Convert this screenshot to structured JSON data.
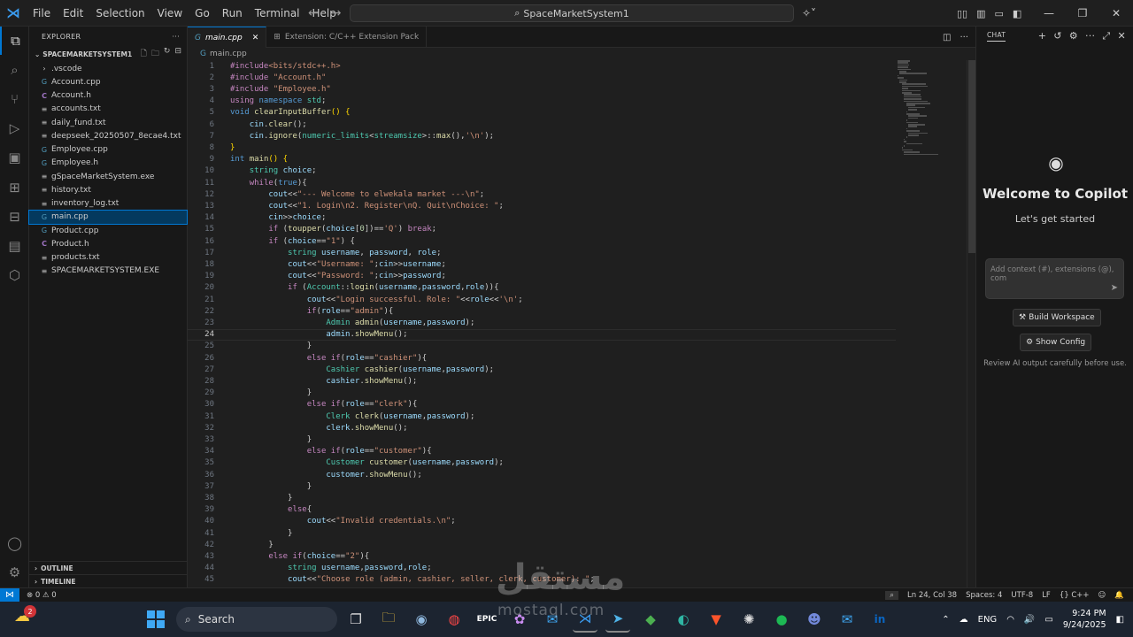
{
  "menu": [
    "File",
    "Edit",
    "Selection",
    "View",
    "Go",
    "Run",
    "Terminal",
    "Help"
  ],
  "search_label": "SpaceMarketSystem1",
  "explorer": {
    "title": "EXPLORER",
    "folder": "SPACEMARKETSYSTEM1",
    "files": [
      {
        "name": ".vscode",
        "type": "folder"
      },
      {
        "name": "Account.cpp",
        "type": "cpp"
      },
      {
        "name": "Account.h",
        "type": "h"
      },
      {
        "name": "accounts.txt",
        "type": "txt"
      },
      {
        "name": "daily_fund.txt",
        "type": "txt"
      },
      {
        "name": "deepseek_20250507_8ecae4.txt",
        "type": "txt"
      },
      {
        "name": "Employee.cpp",
        "type": "cpp"
      },
      {
        "name": "Employee.h",
        "type": "cpp"
      },
      {
        "name": "gSpaceMarketSystem.exe",
        "type": "txt"
      },
      {
        "name": "history.txt",
        "type": "txt"
      },
      {
        "name": "inventory_log.txt",
        "type": "txt"
      },
      {
        "name": "main.cpp",
        "type": "cpp"
      },
      {
        "name": "Product.cpp",
        "type": "cpp"
      },
      {
        "name": "Product.h",
        "type": "h"
      },
      {
        "name": "products.txt",
        "type": "txt"
      },
      {
        "name": "SPACEMARKETSYSTEM.EXE",
        "type": "txt"
      }
    ],
    "outline": "OUTLINE",
    "timeline": "TIMELINE"
  },
  "tabs": [
    {
      "label": "main.cpp",
      "active": true
    },
    {
      "label": "Extension: C/C++ Extension Pack",
      "active": false
    }
  ],
  "breadcrumb": "main.cpp",
  "code": {
    "current_line": 24,
    "lines": [
      {
        "n": "1",
        "html": "<span class='c'>#include</span><span class='s'>&lt;bits/stdc++.h&gt;</span>"
      },
      {
        "n": "2",
        "html": "<span class='c'>#include</span> <span class='s'>\"Account.h\"</span>"
      },
      {
        "n": "3",
        "html": "<span class='c'>#include</span> <span class='s'>\"Employee.h\"</span>"
      },
      {
        "n": "4",
        "html": "<span class='c'>using</span> <span class='k'>namespace</span> <span class='t'>std</span>;"
      },
      {
        "n": "5",
        "html": "<span class='k'>void</span> <span class='f'>clearInputBuffer</span><span class='p'>()</span> <span class='p'>{</span>"
      },
      {
        "n": "6",
        "html": "    <span class='v'>cin</span>.<span class='f'>clear</span>();"
      },
      {
        "n": "7",
        "html": "    <span class='v'>cin</span>.<span class='f'>ignore</span>(<span class='t'>numeric_limits</span>&lt;<span class='t'>streamsize</span>&gt;::<span class='f'>max</span>(),<span class='s'>'\\n'</span>);"
      },
      {
        "n": "8",
        "html": "<span class='p'>}</span>"
      },
      {
        "n": "9",
        "html": "<span class='k'>int</span> <span class='f'>main</span><span class='p'>()</span> <span class='p'>{</span>"
      },
      {
        "n": "10",
        "html": "    <span class='t'>string</span> <span class='v'>choice</span>;"
      },
      {
        "n": "11",
        "html": "    <span class='c'>while</span>(<span class='k'>true</span>){"
      },
      {
        "n": "12",
        "html": "        <span class='v'>cout</span>&lt;&lt;<span class='s'>\"--- Welcome to elwekala market ---\\n\"</span>;"
      },
      {
        "n": "13",
        "html": "        <span class='v'>cout</span>&lt;&lt;<span class='s'>\"1. Login\\n2. Register\\nQ. Quit\\nChoice: \"</span>;"
      },
      {
        "n": "14",
        "html": "        <span class='v'>cin</span>&gt;&gt;<span class='v'>choice</span>;"
      },
      {
        "n": "15",
        "html": "        <span class='c'>if</span> (<span class='f'>toupper</span>(<span class='v'>choice</span>[<span class='n'>0</span>])==<span class='s'>'Q'</span>) <span class='c'>break</span>;"
      },
      {
        "n": "16",
        "html": "        <span class='c'>if</span> (<span class='v'>choice</span>==<span class='s'>\"1\"</span>) {"
      },
      {
        "n": "17",
        "html": "            <span class='t'>string</span> <span class='v'>username</span>, <span class='v'>password</span>, <span class='v'>role</span>;"
      },
      {
        "n": "18",
        "html": "            <span class='v'>cout</span>&lt;&lt;<span class='s'>\"Username: \"</span>;<span class='v'>cin</span>&gt;&gt;<span class='v'>username</span>;"
      },
      {
        "n": "19",
        "html": "            <span class='v'>cout</span>&lt;&lt;<span class='s'>\"Password: \"</span>;<span class='v'>cin</span>&gt;&gt;<span class='v'>password</span>;"
      },
      {
        "n": "20",
        "html": "            <span class='c'>if</span> (<span class='t'>Account</span>::<span class='f'>login</span>(<span class='v'>username</span>,<span class='v'>password</span>,<span class='v'>role</span>)){"
      },
      {
        "n": "21",
        "html": "                <span class='v'>cout</span>&lt;&lt;<span class='s'>\"Login successful. Role: \"</span>&lt;&lt;<span class='v'>role</span>&lt;&lt;<span class='s'>'\\n'</span>;"
      },
      {
        "n": "22",
        "html": "                <span class='c'>if</span>(<span class='v'>role</span>==<span class='s'>\"admin\"</span>){"
      },
      {
        "n": "23",
        "html": "                    <span class='t'>Admin</span> <span class='f'>admin</span>(<span class='v'>username</span>,<span class='v'>password</span>);"
      },
      {
        "n": "24",
        "html": "                    <span class='v'>admin</span>.<span class='f'>showMenu</span>();"
      },
      {
        "n": "25",
        "html": "                }"
      },
      {
        "n": "26",
        "html": "                <span class='c'>else if</span>(<span class='v'>role</span>==<span class='s'>\"cashier\"</span>){"
      },
      {
        "n": "27",
        "html": "                    <span class='t'>Cashier</span> <span class='f'>cashier</span>(<span class='v'>username</span>,<span class='v'>password</span>);"
      },
      {
        "n": "28",
        "html": "                    <span class='v'>cashier</span>.<span class='f'>showMenu</span>();"
      },
      {
        "n": "29",
        "html": "                }"
      },
      {
        "n": "30",
        "html": "                <span class='c'>else if</span>(<span class='v'>role</span>==<span class='s'>\"clerk\"</span>){"
      },
      {
        "n": "31",
        "html": "                    <span class='t'>Clerk</span> <span class='f'>clerk</span>(<span class='v'>username</span>,<span class='v'>password</span>);"
      },
      {
        "n": "32",
        "html": "                    <span class='v'>clerk</span>.<span class='f'>showMenu</span>();"
      },
      {
        "n": "33",
        "html": "                }"
      },
      {
        "n": "34",
        "html": "                <span class='c'>else if</span>(<span class='v'>role</span>==<span class='s'>\"customer\"</span>){"
      },
      {
        "n": "35",
        "html": "                    <span class='t'>Customer</span> <span class='f'>customer</span>(<span class='v'>username</span>,<span class='v'>password</span>);"
      },
      {
        "n": "36",
        "html": "                    <span class='v'>customer</span>.<span class='f'>showMenu</span>();"
      },
      {
        "n": "37",
        "html": "                }"
      },
      {
        "n": "38",
        "html": "            }"
      },
      {
        "n": "39",
        "html": "            <span class='c'>else</span>{"
      },
      {
        "n": "40",
        "html": "                <span class='v'>cout</span>&lt;&lt;<span class='s'>\"Invalid credentials.\\n\"</span>;"
      },
      {
        "n": "41",
        "html": "            }"
      },
      {
        "n": "42",
        "html": "        }"
      },
      {
        "n": "43",
        "html": "        <span class='c'>else if</span>(<span class='v'>choice</span>==<span class='s'>\"2\"</span>){"
      },
      {
        "n": "44",
        "html": "            <span class='t'>string</span> <span class='v'>username</span>,<span class='v'>password</span>,<span class='v'>role</span>;"
      },
      {
        "n": "45",
        "html": "            <span class='v'>cout</span>&lt;&lt;<span class='s'>\"Choose role (admin, cashier, seller, clerk, customer): \"</span>;"
      }
    ]
  },
  "chat": {
    "header": "CHAT",
    "welcome": "Welcome to Copilot",
    "subtitle": "Let's get started",
    "input_placeholder": "Add context (#), extensions (@), com",
    "build_label": "Build Workspace",
    "config_label": "Show Config",
    "review_text": "Review AI output carefully before use."
  },
  "status": {
    "problems": "0",
    "warnings": "0",
    "position": "Ln 24, Col 38",
    "spaces": "Spaces: 4",
    "encoding": "UTF-8",
    "eol": "LF",
    "language": "C++"
  },
  "taskbar": {
    "search": "Search",
    "notif_count": "2",
    "lang": "ENG",
    "time": "9:24 PM",
    "date": "9/24/2025"
  },
  "watermark": {
    "arabic": "مستقل",
    "latin": "mostaql.com"
  }
}
